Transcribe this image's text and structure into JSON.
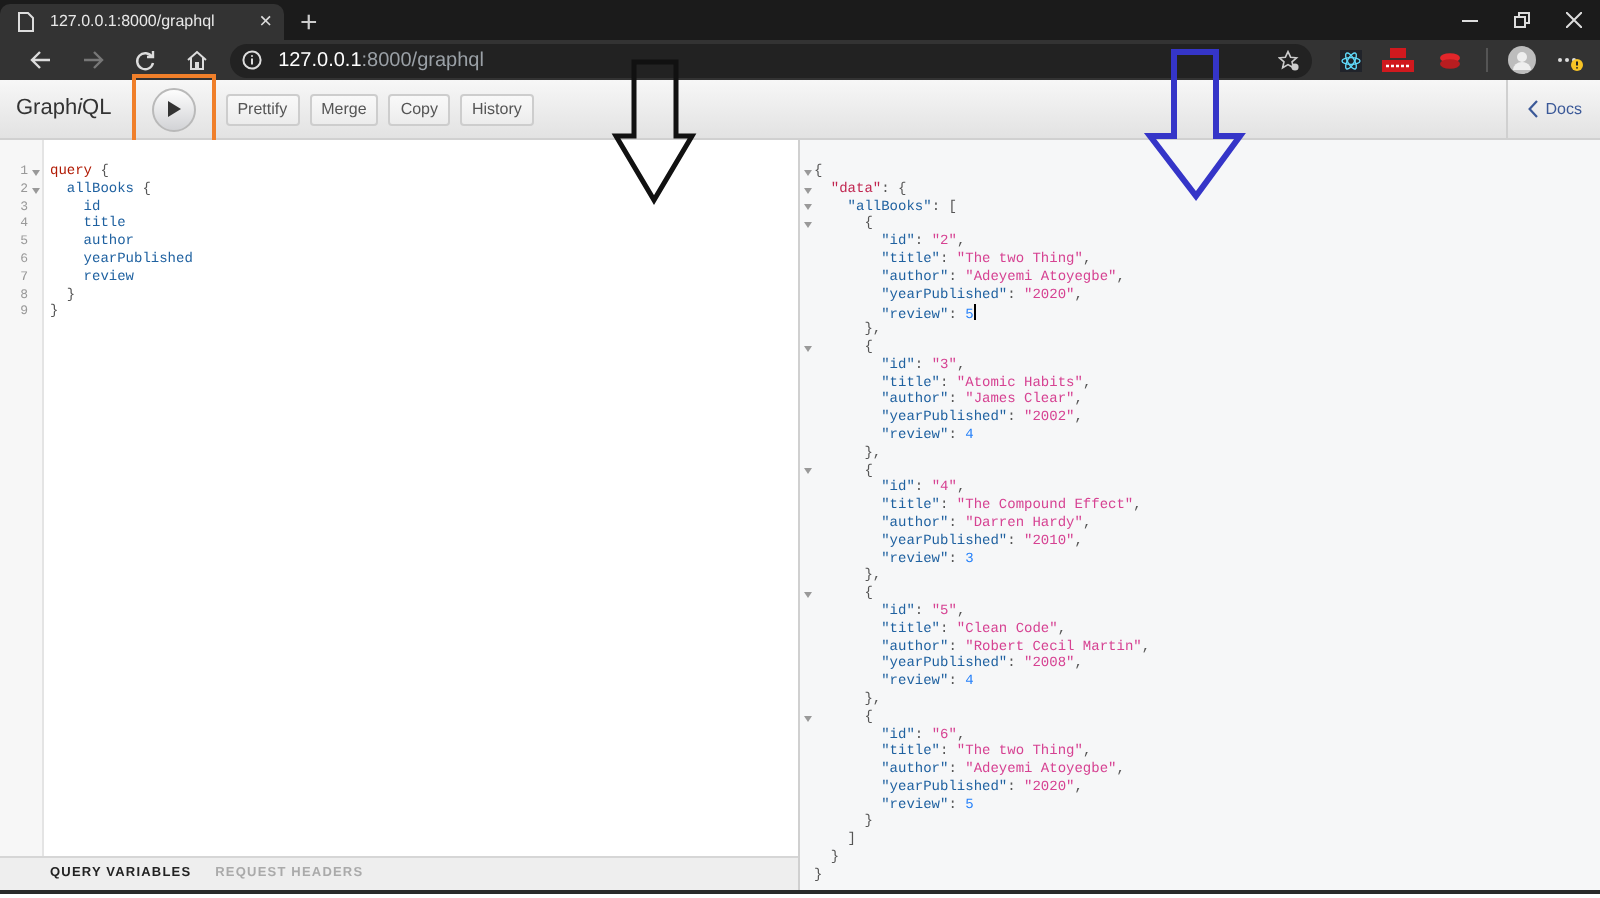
{
  "browser": {
    "tab_title": "127.0.0.1:8000/graphql",
    "new_tab": "+",
    "close_tab": "×",
    "url_host": "127.0.0.1",
    "url_rest": ":8000/graphql"
  },
  "toolbar": {
    "title_parts": [
      {
        "text": "Graph",
        "italic": false
      },
      {
        "text": "i",
        "italic": true
      },
      {
        "text": "QL",
        "italic": false
      }
    ],
    "execute_highlighted": true,
    "buttons": [
      "Prettify",
      "Merge",
      "Copy",
      "History"
    ],
    "docs": "Docs"
  },
  "query_editor": {
    "lines": [
      {
        "number": "1",
        "foldable": true,
        "tokens": [
          {
            "text": "query",
            "kind": "keyword"
          },
          {
            "text": " {",
            "kind": "punct"
          }
        ]
      },
      {
        "number": "2",
        "foldable": true,
        "tokens": [
          {
            "text": "  allBooks",
            "kind": "field"
          },
          {
            "text": " {",
            "kind": "punct"
          }
        ]
      },
      {
        "number": "3",
        "foldable": false,
        "tokens": [
          {
            "text": "    id",
            "kind": "field"
          }
        ]
      },
      {
        "number": "4",
        "foldable": false,
        "tokens": [
          {
            "text": "    title",
            "kind": "field"
          }
        ]
      },
      {
        "number": "5",
        "foldable": false,
        "tokens": [
          {
            "text": "    author",
            "kind": "field"
          }
        ]
      },
      {
        "number": "6",
        "foldable": false,
        "tokens": [
          {
            "text": "    yearPublished",
            "kind": "field"
          }
        ]
      },
      {
        "number": "7",
        "foldable": false,
        "tokens": [
          {
            "text": "    review",
            "kind": "field"
          }
        ]
      },
      {
        "number": "8",
        "foldable": false,
        "tokens": [
          {
            "text": "  }",
            "kind": "punct"
          }
        ]
      },
      {
        "number": "9",
        "foldable": false,
        "tokens": [
          {
            "text": "}",
            "kind": "punct"
          }
        ]
      }
    ]
  },
  "bottom_tabs": [
    {
      "label": "QUERY VARIABLES",
      "selected": true
    },
    {
      "label": "REQUEST HEADERS",
      "selected": false
    }
  ],
  "result": {
    "lines": [
      {
        "foldable": true,
        "tokens": [
          {
            "text": "{",
            "kind": "punct"
          }
        ]
      },
      {
        "foldable": true,
        "tokens": [
          {
            "text": "  \"data\"",
            "kind": "rootkey"
          },
          {
            "text": ": {",
            "kind": "punct"
          }
        ]
      },
      {
        "foldable": true,
        "tokens": [
          {
            "text": "    \"allBooks\"",
            "kind": "key"
          },
          {
            "text": ": [",
            "kind": "punct"
          }
        ]
      },
      {
        "foldable": true,
        "tokens": [
          {
            "text": "      {",
            "kind": "punct"
          }
        ]
      },
      {
        "foldable": false,
        "tokens": [
          {
            "text": "        \"id\"",
            "kind": "key"
          },
          {
            "text": ": ",
            "kind": "punct"
          },
          {
            "text": "\"2\"",
            "kind": "string"
          },
          {
            "text": ",",
            "kind": "punct"
          }
        ]
      },
      {
        "foldable": false,
        "tokens": [
          {
            "text": "        \"title\"",
            "kind": "key"
          },
          {
            "text": ": ",
            "kind": "punct"
          },
          {
            "text": "\"The two Thing\"",
            "kind": "string"
          },
          {
            "text": ",",
            "kind": "punct"
          }
        ]
      },
      {
        "foldable": false,
        "tokens": [
          {
            "text": "        \"author\"",
            "kind": "key"
          },
          {
            "text": ": ",
            "kind": "punct"
          },
          {
            "text": "\"Adeyemi Atoyegbe\"",
            "kind": "string"
          },
          {
            "text": ",",
            "kind": "punct"
          }
        ]
      },
      {
        "foldable": false,
        "tokens": [
          {
            "text": "        \"yearPublished\"",
            "kind": "key"
          },
          {
            "text": ": ",
            "kind": "punct"
          },
          {
            "text": "\"2020\"",
            "kind": "string"
          },
          {
            "text": ",",
            "kind": "punct"
          }
        ]
      },
      {
        "foldable": false,
        "cursor": true,
        "tokens": [
          {
            "text": "        \"review\"",
            "kind": "key"
          },
          {
            "text": ": ",
            "kind": "punct"
          },
          {
            "text": "5",
            "kind": "number"
          }
        ]
      },
      {
        "foldable": false,
        "tokens": [
          {
            "text": "      },",
            "kind": "punct"
          }
        ]
      },
      {
        "foldable": true,
        "tokens": [
          {
            "text": "      {",
            "kind": "punct"
          }
        ]
      },
      {
        "foldable": false,
        "tokens": [
          {
            "text": "        \"id\"",
            "kind": "key"
          },
          {
            "text": ": ",
            "kind": "punct"
          },
          {
            "text": "\"3\"",
            "kind": "string"
          },
          {
            "text": ",",
            "kind": "punct"
          }
        ]
      },
      {
        "foldable": false,
        "tokens": [
          {
            "text": "        \"title\"",
            "kind": "key"
          },
          {
            "text": ": ",
            "kind": "punct"
          },
          {
            "text": "\"Atomic Habits\"",
            "kind": "string"
          },
          {
            "text": ",",
            "kind": "punct"
          }
        ]
      },
      {
        "foldable": false,
        "tokens": [
          {
            "text": "        \"author\"",
            "kind": "key"
          },
          {
            "text": ": ",
            "kind": "punct"
          },
          {
            "text": "\"James Clear\"",
            "kind": "string"
          },
          {
            "text": ",",
            "kind": "punct"
          }
        ]
      },
      {
        "foldable": false,
        "tokens": [
          {
            "text": "        \"yearPublished\"",
            "kind": "key"
          },
          {
            "text": ": ",
            "kind": "punct"
          },
          {
            "text": "\"2002\"",
            "kind": "string"
          },
          {
            "text": ",",
            "kind": "punct"
          }
        ]
      },
      {
        "foldable": false,
        "tokens": [
          {
            "text": "        \"review\"",
            "kind": "key"
          },
          {
            "text": ": ",
            "kind": "punct"
          },
          {
            "text": "4",
            "kind": "number"
          }
        ]
      },
      {
        "foldable": false,
        "tokens": [
          {
            "text": "      },",
            "kind": "punct"
          }
        ]
      },
      {
        "foldable": true,
        "tokens": [
          {
            "text": "      {",
            "kind": "punct"
          }
        ]
      },
      {
        "foldable": false,
        "tokens": [
          {
            "text": "        \"id\"",
            "kind": "key"
          },
          {
            "text": ": ",
            "kind": "punct"
          },
          {
            "text": "\"4\"",
            "kind": "string"
          },
          {
            "text": ",",
            "kind": "punct"
          }
        ]
      },
      {
        "foldable": false,
        "tokens": [
          {
            "text": "        \"title\"",
            "kind": "key"
          },
          {
            "text": ": ",
            "kind": "punct"
          },
          {
            "text": "\"The Compound Effect\"",
            "kind": "string"
          },
          {
            "text": ",",
            "kind": "punct"
          }
        ]
      },
      {
        "foldable": false,
        "tokens": [
          {
            "text": "        \"author\"",
            "kind": "key"
          },
          {
            "text": ": ",
            "kind": "punct"
          },
          {
            "text": "\"Darren Hardy\"",
            "kind": "string"
          },
          {
            "text": ",",
            "kind": "punct"
          }
        ]
      },
      {
        "foldable": false,
        "tokens": [
          {
            "text": "        \"yearPublished\"",
            "kind": "key"
          },
          {
            "text": ": ",
            "kind": "punct"
          },
          {
            "text": "\"2010\"",
            "kind": "string"
          },
          {
            "text": ",",
            "kind": "punct"
          }
        ]
      },
      {
        "foldable": false,
        "tokens": [
          {
            "text": "        \"review\"",
            "kind": "key"
          },
          {
            "text": ": ",
            "kind": "punct"
          },
          {
            "text": "3",
            "kind": "number"
          }
        ]
      },
      {
        "foldable": false,
        "tokens": [
          {
            "text": "      },",
            "kind": "punct"
          }
        ]
      },
      {
        "foldable": true,
        "tokens": [
          {
            "text": "      {",
            "kind": "punct"
          }
        ]
      },
      {
        "foldable": false,
        "tokens": [
          {
            "text": "        \"id\"",
            "kind": "key"
          },
          {
            "text": ": ",
            "kind": "punct"
          },
          {
            "text": "\"5\"",
            "kind": "string"
          },
          {
            "text": ",",
            "kind": "punct"
          }
        ]
      },
      {
        "foldable": false,
        "tokens": [
          {
            "text": "        \"title\"",
            "kind": "key"
          },
          {
            "text": ": ",
            "kind": "punct"
          },
          {
            "text": "\"Clean Code\"",
            "kind": "string"
          },
          {
            "text": ",",
            "kind": "punct"
          }
        ]
      },
      {
        "foldable": false,
        "tokens": [
          {
            "text": "        \"author\"",
            "kind": "key"
          },
          {
            "text": ": ",
            "kind": "punct"
          },
          {
            "text": "\"Robert Cecil Martin\"",
            "kind": "string"
          },
          {
            "text": ",",
            "kind": "punct"
          }
        ]
      },
      {
        "foldable": false,
        "tokens": [
          {
            "text": "        \"yearPublished\"",
            "kind": "key"
          },
          {
            "text": ": ",
            "kind": "punct"
          },
          {
            "text": "\"2008\"",
            "kind": "string"
          },
          {
            "text": ",",
            "kind": "punct"
          }
        ]
      },
      {
        "foldable": false,
        "tokens": [
          {
            "text": "        \"review\"",
            "kind": "key"
          },
          {
            "text": ": ",
            "kind": "punct"
          },
          {
            "text": "4",
            "kind": "number"
          }
        ]
      },
      {
        "foldable": false,
        "tokens": [
          {
            "text": "      },",
            "kind": "punct"
          }
        ]
      },
      {
        "foldable": true,
        "tokens": [
          {
            "text": "      {",
            "kind": "punct"
          }
        ]
      },
      {
        "foldable": false,
        "tokens": [
          {
            "text": "        \"id\"",
            "kind": "key"
          },
          {
            "text": ": ",
            "kind": "punct"
          },
          {
            "text": "\"6\"",
            "kind": "string"
          },
          {
            "text": ",",
            "kind": "punct"
          }
        ]
      },
      {
        "foldable": false,
        "tokens": [
          {
            "text": "        \"title\"",
            "kind": "key"
          },
          {
            "text": ": ",
            "kind": "punct"
          },
          {
            "text": "\"The two Thing\"",
            "kind": "string"
          },
          {
            "text": ",",
            "kind": "punct"
          }
        ]
      },
      {
        "foldable": false,
        "tokens": [
          {
            "text": "        \"author\"",
            "kind": "key"
          },
          {
            "text": ": ",
            "kind": "punct"
          },
          {
            "text": "\"Adeyemi Atoyegbe\"",
            "kind": "string"
          },
          {
            "text": ",",
            "kind": "punct"
          }
        ]
      },
      {
        "foldable": false,
        "tokens": [
          {
            "text": "        \"yearPublished\"",
            "kind": "key"
          },
          {
            "text": ": ",
            "kind": "punct"
          },
          {
            "text": "\"2020\"",
            "kind": "string"
          },
          {
            "text": ",",
            "kind": "punct"
          }
        ]
      },
      {
        "foldable": false,
        "tokens": [
          {
            "text": "        \"review\"",
            "kind": "key"
          },
          {
            "text": ": ",
            "kind": "punct"
          },
          {
            "text": "5",
            "kind": "number"
          }
        ]
      },
      {
        "foldable": false,
        "tokens": [
          {
            "text": "      }",
            "kind": "punct"
          }
        ]
      },
      {
        "foldable": false,
        "tokens": [
          {
            "text": "    ]",
            "kind": "punct"
          }
        ]
      },
      {
        "foldable": false,
        "tokens": [
          {
            "text": "  }",
            "kind": "punct"
          }
        ]
      },
      {
        "foldable": false,
        "tokens": [
          {
            "text": "}",
            "kind": "punct"
          }
        ]
      }
    ]
  }
}
